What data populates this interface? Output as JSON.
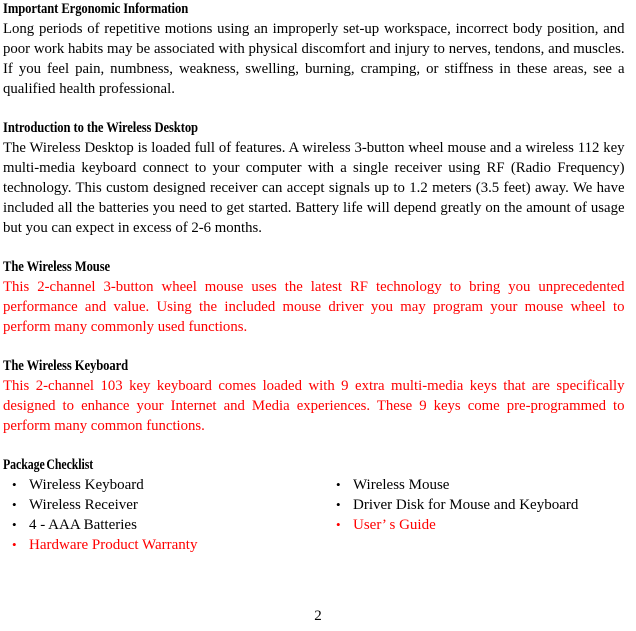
{
  "document": {
    "page_number": "2",
    "colors": {
      "text": "#000000",
      "accent_red": "#ff0000"
    },
    "sections": {
      "ergonomic": {
        "heading": "Important Ergonomic Information",
        "body": "Long periods of repetitive motions using an improperly set-up workspace, incorrect body position, and poor work habits may be associated with physical discomfort and injury to nerves, tendons, and muscles. If you feel pain, numbness, weakness, swelling, burning, cramping, or stiffness in these areas, see a qualified health professional."
      },
      "introduction": {
        "heading": "Introduction to the Wireless Desktop",
        "body": "The Wireless Desktop is loaded full of features. A wireless 3-button wheel mouse and a wireless 112 key multi-media keyboard connect to your computer with a single receiver using RF (Radio Frequency) technology. This custom designed receiver can accept signals up to 1.2 meters (3.5 feet) away. We have included all the batteries you need to get started. Battery life will depend greatly on the amount of usage but you can expect in excess of 2-6 months."
      },
      "mouse": {
        "heading": "The Wireless Mouse",
        "body": "This 2-channel 3-button wheel mouse uses the latest RF technology to bring you unprecedented performance and value. Using the included mouse driver you may program your mouse wheel to perform many commonly used functions."
      },
      "keyboard": {
        "heading": "The Wireless Keyboard",
        "body": "This 2-channel 103 key keyboard comes loaded with 9 extra multi-media keys that are specifically designed to enhance your Internet and Media experiences. These 9 keys come pre-programmed to perform many common functions."
      },
      "package_checklist": {
        "heading": "Package Checklist",
        "bullet_glyph": "•",
        "left_column": [
          {
            "label": "Wireless Keyboard",
            "color": "black"
          },
          {
            "label": "Wireless Receiver",
            "color": "black"
          },
          {
            "label": "4 - AAA Batteries",
            "color": "black"
          },
          {
            "label": "Hardware Product Warranty",
            "color": "red"
          }
        ],
        "right_column": [
          {
            "label": "Wireless Mouse",
            "color": "black"
          },
          {
            "label": "Driver Disk for Mouse and Keyboard",
            "color": "black"
          },
          {
            "label": "User’ s Guide",
            "color": "red"
          }
        ]
      }
    }
  }
}
